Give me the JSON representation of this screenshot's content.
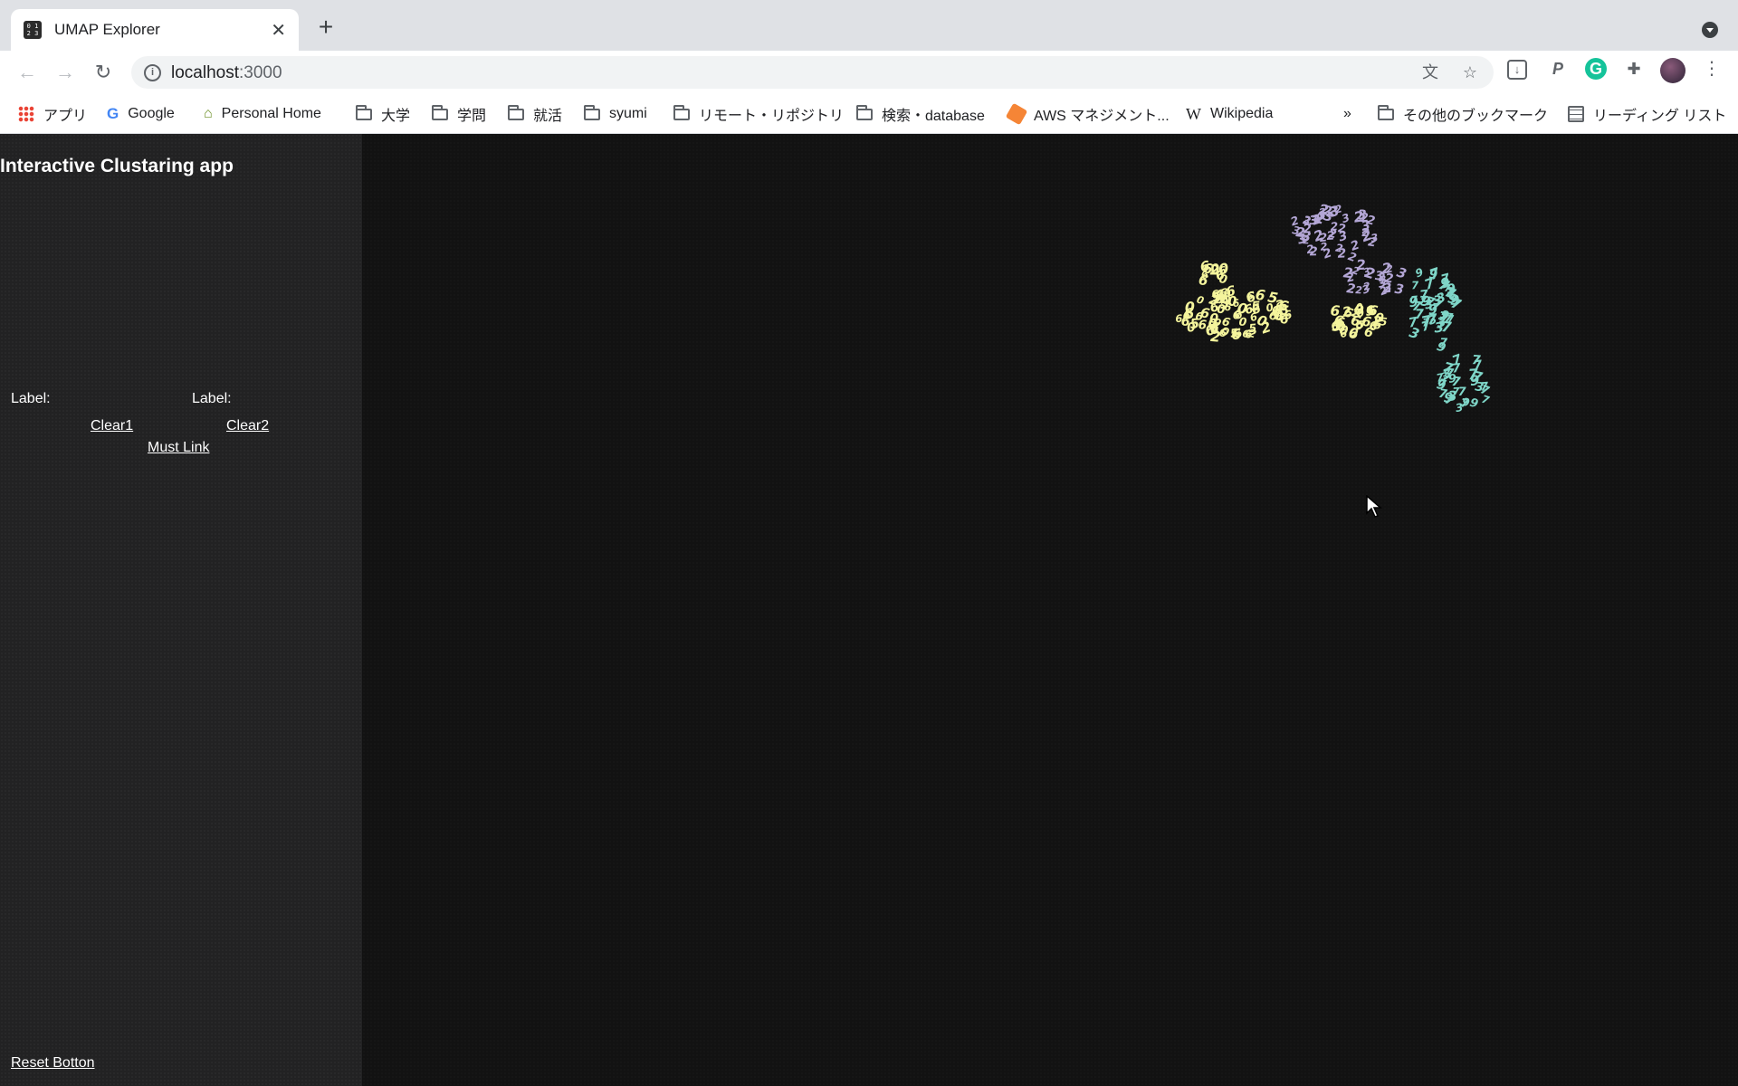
{
  "browser": {
    "tab": {
      "title": "UMAP Explorer",
      "favicon_text": "0 1 2 3"
    },
    "url": {
      "host": "localhost",
      "path": ":3000"
    },
    "bookmarks": [
      {
        "label": "アプリ",
        "icon": "apps-grid-icon"
      },
      {
        "label": "Google",
        "icon": "google-icon"
      },
      {
        "label": "Personal Home",
        "icon": "home-icon"
      },
      {
        "label": "大学",
        "icon": "folder-icon"
      },
      {
        "label": "学問",
        "icon": "folder-icon"
      },
      {
        "label": "就活",
        "icon": "folder-icon"
      },
      {
        "label": "syumi",
        "icon": "folder-icon"
      },
      {
        "label": "リモート・リポジトリ",
        "icon": "folder-icon"
      },
      {
        "label": "検索・database",
        "icon": "folder-icon"
      },
      {
        "label": "AWS マネジメント...",
        "icon": "aws-icon"
      },
      {
        "label": "Wikipedia",
        "icon": "wikipedia-icon"
      }
    ],
    "overflow": "»",
    "other_bookmarks": "その他のブックマーク",
    "reading_list": "リーディング リスト"
  },
  "sidebar": {
    "title": "Interactive Clustaring app",
    "label1": "Label:",
    "label2": "Label:",
    "clear1": "Clear1",
    "clear2": "Clear2",
    "must_link": "Must Link",
    "reset": "Reset Botton"
  },
  "colors": {
    "cluster_yellow": "#f4f49c",
    "cluster_purple": "#b4a7d6",
    "cluster_teal": "#7fd6c8"
  },
  "scatter": {
    "clusters": [
      {
        "name": "yellow",
        "glyphs": [
          "6",
          "0",
          "6",
          "5",
          "6",
          "0",
          "6",
          "2",
          "6"
        ]
      },
      {
        "name": "purple",
        "glyphs": [
          "2",
          "3",
          "2",
          "2",
          "3",
          "2",
          "2"
        ]
      },
      {
        "name": "teal",
        "glyphs": [
          "7",
          "9",
          "7",
          "7",
          "9",
          "7",
          "3"
        ]
      }
    ]
  }
}
